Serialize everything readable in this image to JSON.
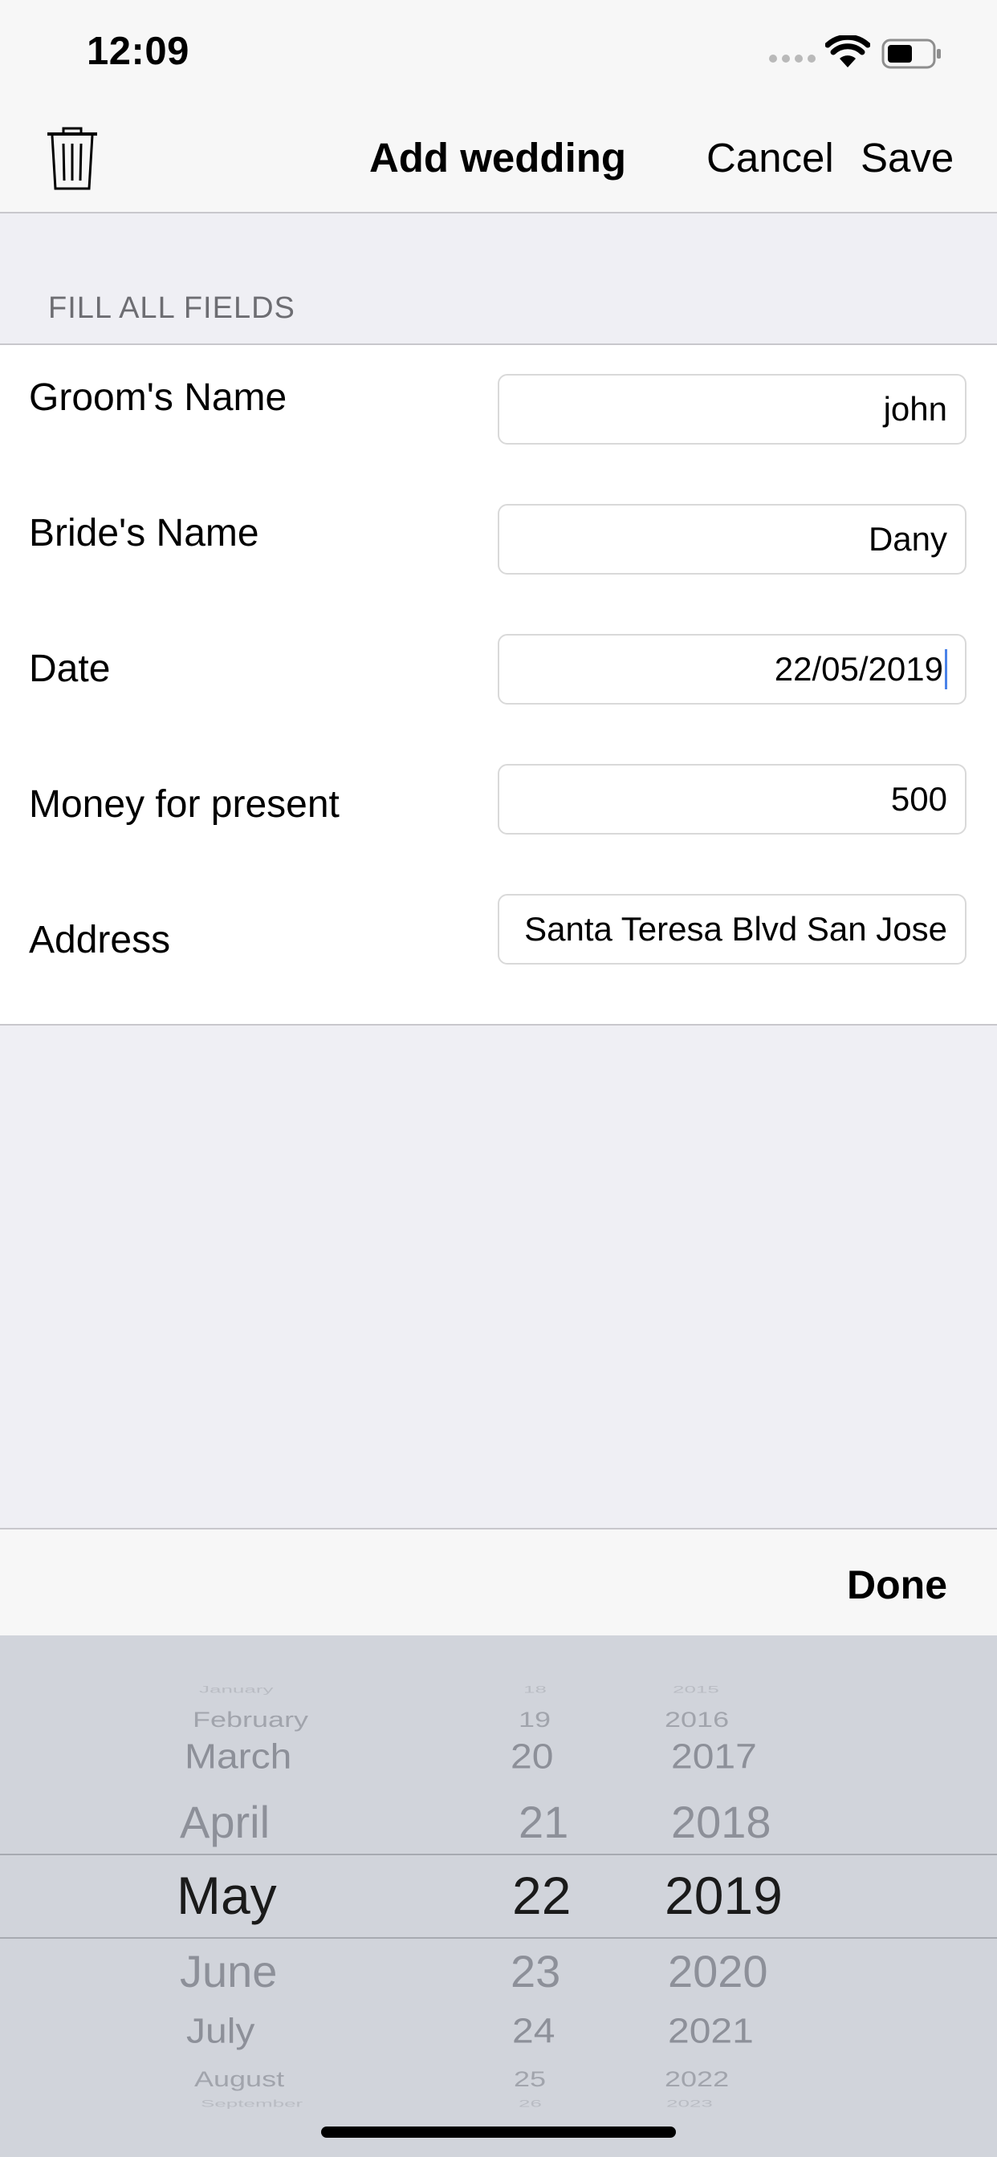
{
  "status_bar": {
    "time": "12:09",
    "signal_icon": "signal-dots-icon",
    "wifi_icon": "wifi-icon",
    "battery_icon": "battery-icon"
  },
  "nav": {
    "title": "Add wedding",
    "cancel_label": "Cancel",
    "save_label": "Save",
    "delete_icon": "trash-icon"
  },
  "form": {
    "section_header": "FILL ALL FIELDS",
    "rows": [
      {
        "label": "Groom's Name",
        "value": "john"
      },
      {
        "label": "Bride's Name",
        "value": "Dany"
      },
      {
        "label": "Date",
        "value": "22/05/2019"
      },
      {
        "label": "Money for present",
        "value": "500"
      },
      {
        "label": "Address",
        "value": "Santa Teresa Blvd San Jose"
      }
    ]
  },
  "toolbar": {
    "done_label": "Done"
  },
  "picker": {
    "months": [
      "January",
      "February",
      "March",
      "April",
      "May",
      "June",
      "July",
      "August",
      "September"
    ],
    "days": [
      "18",
      "19",
      "20",
      "21",
      "22",
      "23",
      "24",
      "25",
      "26"
    ],
    "years": [
      "2015",
      "2016",
      "2017",
      "2018",
      "2019",
      "2020",
      "2021",
      "2022",
      "2023"
    ],
    "selected_index": 4
  }
}
